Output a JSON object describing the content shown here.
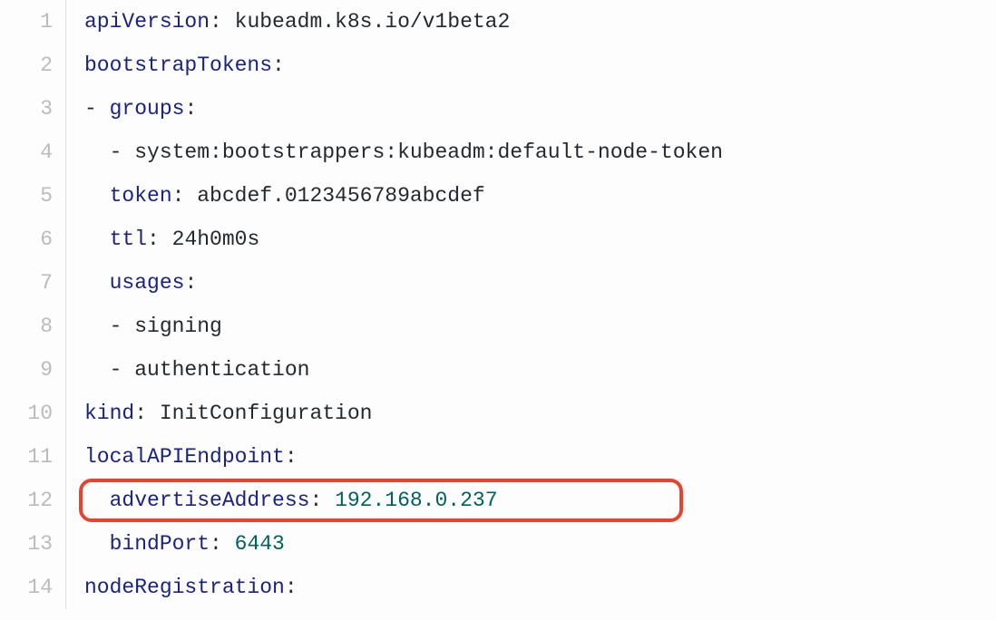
{
  "lines": [
    {
      "n": "1"
    },
    {
      "n": "2"
    },
    {
      "n": "3"
    },
    {
      "n": "4"
    },
    {
      "n": "5"
    },
    {
      "n": "6"
    },
    {
      "n": "7"
    },
    {
      "n": "8"
    },
    {
      "n": "9"
    },
    {
      "n": "10"
    },
    {
      "n": "11"
    },
    {
      "n": "12"
    },
    {
      "n": "13"
    },
    {
      "n": "14"
    }
  ],
  "code": {
    "l1_key": "apiVersion",
    "l1_punct": ": ",
    "l1_val": "kubeadm.k8s.io/v1beta2",
    "l2_key": "bootstrapTokens",
    "l2_punct": ":",
    "l3_pre": "- ",
    "l3_key": "groups",
    "l3_punct": ":",
    "l4_pre": "  - ",
    "l4_val": "system:bootstrappers:kubeadm:default-node-token",
    "l5_pre": "  ",
    "l5_key": "token",
    "l5_punct": ": ",
    "l5_val": "abcdef.0123456789abcdef",
    "l6_pre": "  ",
    "l6_key": "ttl",
    "l6_punct": ": ",
    "l6_val": "24h0m0s",
    "l7_pre": "  ",
    "l7_key": "usages",
    "l7_punct": ":",
    "l8_pre": "  - ",
    "l8_val": "signing",
    "l9_pre": "  - ",
    "l9_val": "authentication",
    "l10_key": "kind",
    "l10_punct": ": ",
    "l10_val": "InitConfiguration",
    "l11_key": "localAPIEndpoint",
    "l11_punct": ":",
    "l12_pre": "  ",
    "l12_key": "advertiseAddress",
    "l12_punct": ": ",
    "l12_val": "192.168.0.237",
    "l13_pre": "  ",
    "l13_key": "bindPort",
    "l13_punct": ": ",
    "l13_val": "6443",
    "l14_key": "nodeRegistration",
    "l14_punct": ":"
  }
}
